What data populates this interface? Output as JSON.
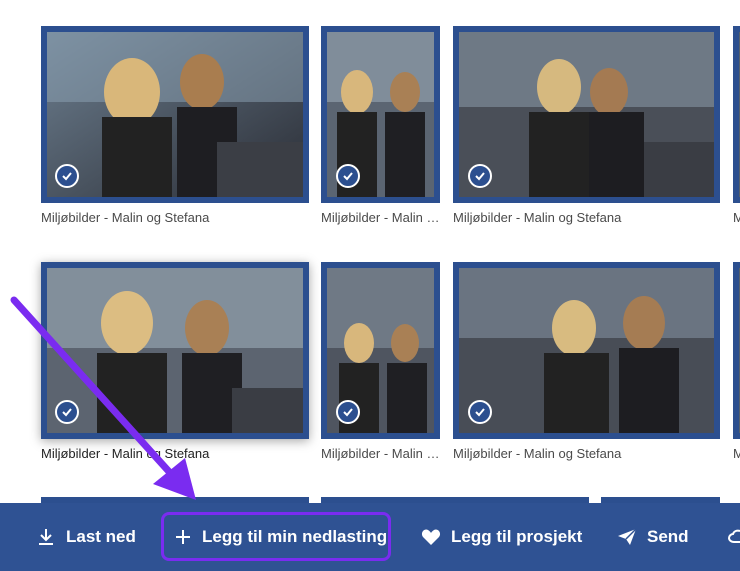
{
  "gallery": {
    "row1": [
      {
        "caption": "Miljøbilder - Malin og Stefana"
      },
      {
        "caption": "Miljøbilder - Malin og Stefana"
      },
      {
        "caption": "Miljøbilder - Malin og Stefana"
      },
      {
        "caption": "Miljøbilder - Malin og Stefana"
      }
    ],
    "row2": [
      {
        "caption": "Miljøbilder - Malin og Stefana"
      },
      {
        "caption": "Miljøbilder - Malin og Stefana"
      },
      {
        "caption": "Miljøbilder - Malin og Stefana"
      },
      {
        "caption": "Miljøbilder - Malin og Stefana"
      }
    ]
  },
  "toolbar": {
    "download_label": "Last ned",
    "add_to_downloads_label": "Legg til min nedlasting",
    "add_to_project_label": "Legg til prosjekt",
    "send_label": "Send"
  },
  "colors": {
    "accent": "#2f5293",
    "highlight": "#7a2cf0"
  }
}
